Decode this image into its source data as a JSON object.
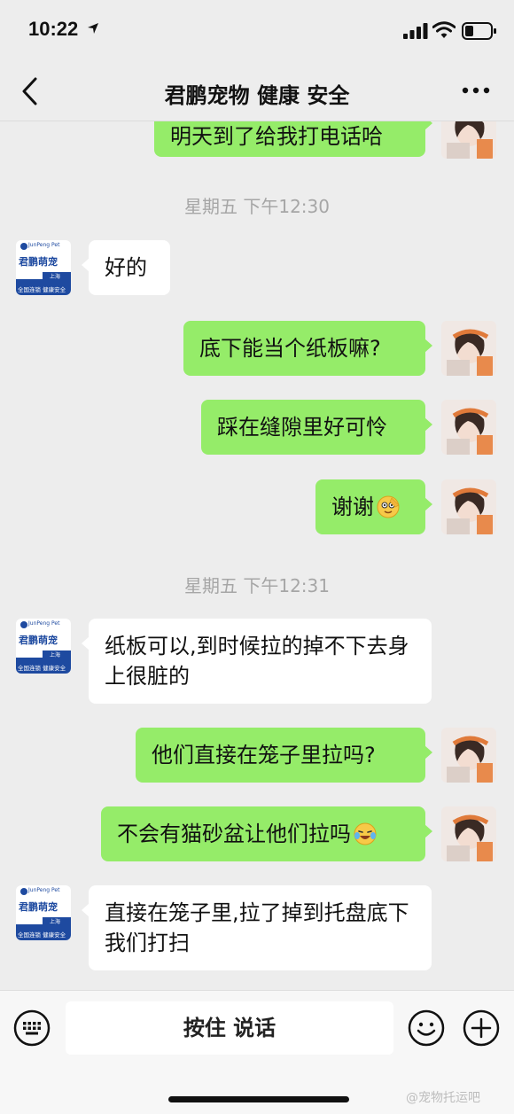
{
  "status": {
    "time": "10:22"
  },
  "nav": {
    "title": "君鹏宠物 健康 安全"
  },
  "messages": [
    {
      "text": "明天到了给我打电话哈"
    },
    {
      "timestamp": "星期五 下午12:30"
    },
    {
      "text": "好的"
    },
    {
      "text": "底下能当个纸板嘛?"
    },
    {
      "text": "踩在缝隙里好可怜"
    },
    {
      "text": "谢谢"
    },
    {
      "timestamp": "星期五 下午12:31"
    },
    {
      "text": "纸板可以,到时候拉的掉不下去身上很脏的"
    },
    {
      "text": "他们直接在笼子里拉吗?"
    },
    {
      "text": "不会有猫砂盆让他们拉吗"
    },
    {
      "text": "直接在笼子里,拉了掉到托盘底下我们打扫"
    }
  ],
  "bottom": {
    "voice_label": "按住 说话"
  },
  "avatar_other": {
    "brand_en": "JunPeng Pet",
    "brand_cn": "君鹏萌宠",
    "city": "上海",
    "tagline": "全国连锁 健康安全"
  },
  "watermark": "@宠物托运吧",
  "colors": {
    "self_bubble": "#95ec69",
    "other_bubble": "#ffffff",
    "background": "#ededed"
  }
}
